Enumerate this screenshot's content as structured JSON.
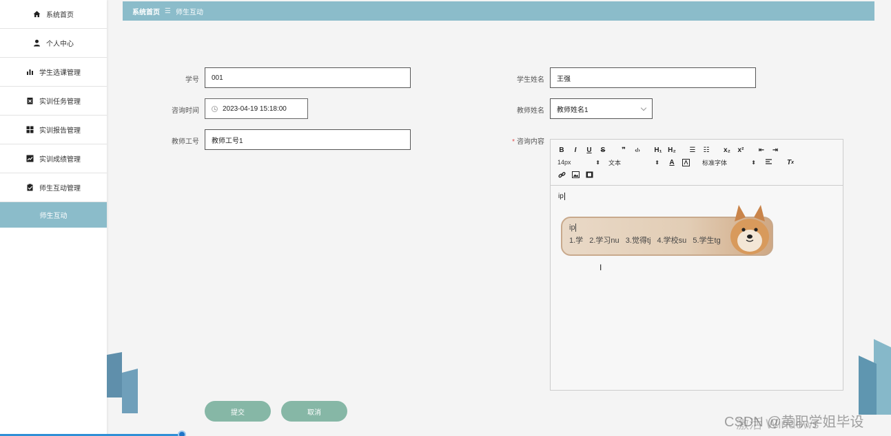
{
  "sidebar": {
    "items": [
      {
        "label": "系统首页",
        "icon": "home-icon"
      },
      {
        "label": "个人中心",
        "icon": "user-icon"
      },
      {
        "label": "学生选课管理",
        "icon": "bar-chart-icon"
      },
      {
        "label": "实训任务管理",
        "icon": "task-icon"
      },
      {
        "label": "实训报告管理",
        "icon": "grid-icon"
      },
      {
        "label": "实训成绩管理",
        "icon": "trend-icon"
      },
      {
        "label": "师生互动管理",
        "icon": "clipboard-icon"
      },
      {
        "label": "师生互动",
        "active": true
      }
    ]
  },
  "breadcrumb": {
    "home": "系统首页",
    "separator": "☰",
    "current": "师生互动"
  },
  "form": {
    "student_no": {
      "label": "学号",
      "value": "001"
    },
    "student_name": {
      "label": "学生姓名",
      "value": "王强"
    },
    "consult_time": {
      "label": "咨询时间",
      "value": "2023-04-19 15:18:00"
    },
    "teacher_name": {
      "label": "教师姓名",
      "value": "教师姓名1"
    },
    "teacher_no": {
      "label": "教师工号",
      "value": "教师工号1"
    },
    "consult_content": {
      "label": "咨询内容",
      "required": "*",
      "value": "ip"
    }
  },
  "editor": {
    "row1": [
      "B",
      "I",
      "U",
      "S",
      "❞",
      "‹/›",
      "H₁",
      "H₂",
      "☰",
      "☷",
      "x₂",
      "x²",
      "⇤",
      "⇥"
    ],
    "font_size": "14px",
    "text_type": "文本",
    "font_family": "标准字体"
  },
  "ime": {
    "composition": "ip",
    "candidates": [
      "1.学",
      "2.学习nu",
      "3.觉得tj",
      "4.学校su",
      "5.学生tg"
    ]
  },
  "buttons": {
    "submit": "提交",
    "cancel": "取消"
  },
  "watermark": {
    "text1": "激活 Windows",
    "text2": "CSDN @黄职学姐毕设"
  },
  "colors": {
    "accent": "#8bbcca",
    "button": "#86b7a6",
    "required": "#e05050"
  }
}
